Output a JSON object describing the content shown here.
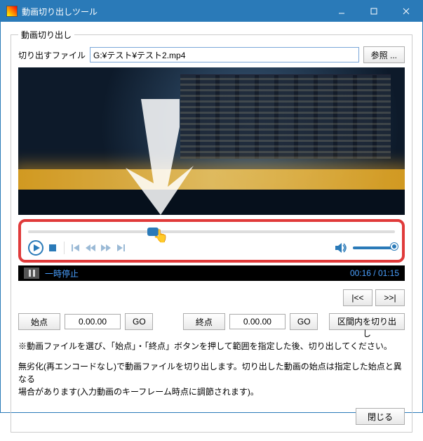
{
  "window": {
    "title": "動画切り出しツール"
  },
  "group": {
    "legend": "動画切り出し"
  },
  "file": {
    "label": "切り出すファイル",
    "path": "G:¥テスト¥テスト2.mp4",
    "browse": "参照 ..."
  },
  "status": {
    "state": "一時停止",
    "time": "00:16 / 01:15"
  },
  "nav": {
    "prev": "|<<",
    "next": ">>|"
  },
  "cut": {
    "start_label": "始点",
    "start_value": "0.00.00",
    "start_go": "GO",
    "end_label": "終点",
    "end_value": "0.00.00",
    "end_go": "GO",
    "crop": "区間内を切り出し"
  },
  "note": "※動画ファイルを選び、「始点」・「終点」ボタンを押して範囲を指定した後、切り出してください。",
  "desc1": "無劣化(再エンコードなし)で動画ファイルを切り出します。切り出した動画の始点は指定した始点と異なる",
  "desc2": "場合があります(入力動画のキーフレーム時点に調節されます)。",
  "close": "閉じる"
}
